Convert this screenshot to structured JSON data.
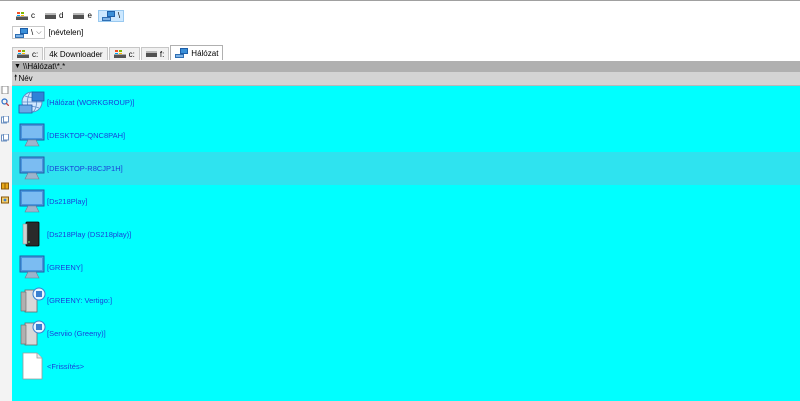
{
  "drives": [
    {
      "label": "c",
      "icon": "windows-drive-icon"
    },
    {
      "label": "d",
      "icon": "drive-icon"
    },
    {
      "label": "e",
      "icon": "drive-icon"
    },
    {
      "label": "\\",
      "icon": "network-icon",
      "active": true
    }
  ],
  "path": {
    "drive_label": "\\",
    "name": "[névtelen]"
  },
  "tabs": [
    {
      "label": "c:",
      "icon": "windows-drive-icon"
    },
    {
      "label": "4k Downloader",
      "icon": ""
    },
    {
      "label": "c:",
      "icon": "windows-drive-icon"
    },
    {
      "label": "f:",
      "icon": "drive-icon"
    },
    {
      "label": "Hálózat",
      "icon": "network-icon",
      "active": true
    }
  ],
  "address": "\\\\Hálózat\\*.*",
  "column_header": "Név",
  "items": [
    {
      "label": "[Hálózat (WORKGROUP)]",
      "icon": "network-globe-icon"
    },
    {
      "label": "[DESKTOP-QNC8PAH]",
      "icon": "computer-monitor-icon"
    },
    {
      "label": "[DESKTOP-R8CJP1H]",
      "icon": "computer-monitor-icon",
      "selected": true
    },
    {
      "label": "[Ds218Play]",
      "icon": "computer-monitor-icon"
    },
    {
      "label": "[Ds218Play (DS218play)]",
      "icon": "nas-server-icon"
    },
    {
      "label": "[GREENY]",
      "icon": "computer-monitor-icon"
    },
    {
      "label": "[GREENY: Vertigo:]",
      "icon": "media-server-icon"
    },
    {
      "label": "[Serviio (Greeny)]",
      "icon": "media-server-icon"
    },
    {
      "label": "<Frissítés>",
      "icon": "blank-file-icon"
    }
  ],
  "colors": {
    "list_bg": "#00ffff",
    "selected_row": "#2fe3ef",
    "item_text": "#1a3fd8",
    "address_bar": "#b0b0b0",
    "column_header": "#d4d4d4"
  }
}
